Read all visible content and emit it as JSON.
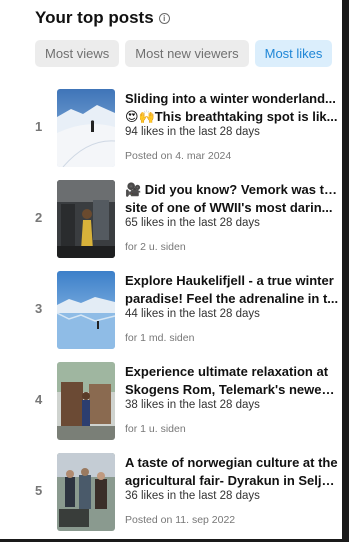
{
  "header": {
    "title": "Your top posts",
    "info_glyph": "i"
  },
  "tabs": [
    {
      "label": "Most views",
      "active": false
    },
    {
      "label": "Most new viewers",
      "active": false
    },
    {
      "label": "Most likes",
      "active": true
    }
  ],
  "posts": [
    {
      "rank": "1",
      "title_line1": "Sliding into a winter wonderland...",
      "title_line2": "😍🙌This breathtaking spot is lik...",
      "likes": "94 likes in the last 28 days",
      "posted": "Posted on 4. mar 2024"
    },
    {
      "rank": "2",
      "title_line1": "🎥 Did you know? Vemork was the",
      "title_line2": "site of one of WWII's most darin...",
      "likes": "65 likes in the last 28 days",
      "posted": "for 2 u. siden"
    },
    {
      "rank": "3",
      "title_line1": "Explore Haukelifjell - a true winter",
      "title_line2": "paradise! Feel the adrenaline in t...",
      "likes": "44 likes in the last 28 days",
      "posted": "for 1 md. siden"
    },
    {
      "rank": "4",
      "title_line1": "Experience ultimate relaxation at",
      "title_line2": "Skogens Rom, Telemark's newes...",
      "likes": "38 likes in the last 28 days",
      "posted": "for 1 u. siden"
    },
    {
      "rank": "5",
      "title_line1": "A taste of norwegian culture at the",
      "title_line2": "agricultural fair- Dyrakun in Seljo...",
      "likes": "36 likes in the last 28 days",
      "posted": "Posted on 11. sep 2022"
    }
  ],
  "colors": {
    "accent": "#1f86d6",
    "active_tab_bg": "#dbeefc",
    "inactive_tab_bg": "#ececec"
  }
}
